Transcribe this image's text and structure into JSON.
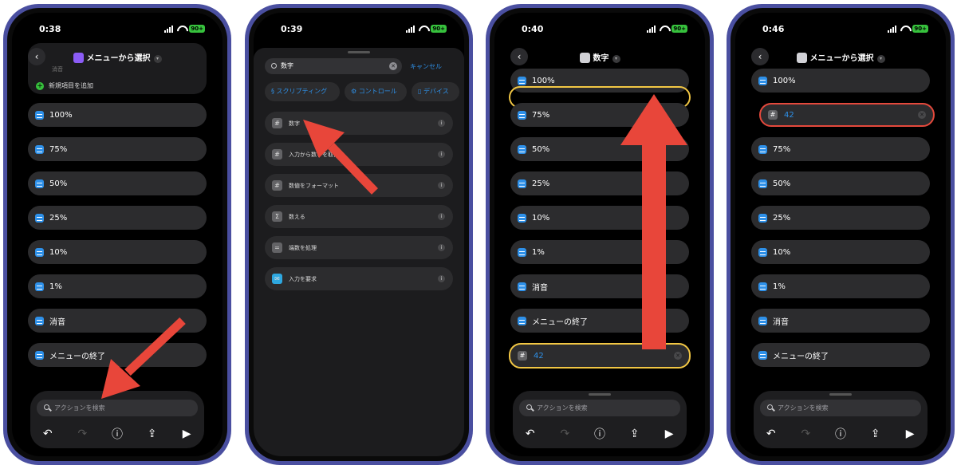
{
  "colors": {
    "accent": "#2e90e8",
    "battery": "#37c23d",
    "annotation_arrow": "#e8463a",
    "highlight_yellow": "#f2c744",
    "highlight_red": "#e5493c",
    "shortcut_icon": "#8b5cf6"
  },
  "phones": [
    {
      "time": "0:38",
      "battery": "90+",
      "title": "メニューから選択",
      "sheet_partial_label": "消音",
      "add_new_item": "新規項目を追加",
      "items": [
        "100%",
        "75%",
        "50%",
        "25%",
        "10%",
        "1%",
        "消音",
        "メニューの終了"
      ],
      "search_placeholder": "アクションを検索"
    },
    {
      "time": "0:39",
      "battery": "90+",
      "search_value": "数字",
      "cancel": "キャンセル",
      "chips": [
        "スクリプティング",
        "コントロール",
        "デバイス"
      ],
      "results": [
        {
          "label": "数字",
          "icon": "number-icon"
        },
        {
          "label": "入力から数字を取得",
          "icon": "number-icon"
        },
        {
          "label": "数値をフォーマット",
          "icon": "number-icon"
        },
        {
          "label": "数える",
          "icon": "sigma-icon"
        },
        {
          "label": "端数を処理",
          "icon": "equals-icon"
        },
        {
          "label": "入力を要求",
          "icon": "chat-icon"
        }
      ]
    },
    {
      "time": "0:40",
      "battery": "90+",
      "title": "数字",
      "items": [
        "100%",
        "75%",
        "50%",
        "25%",
        "10%",
        "1%",
        "消音",
        "メニューの終了"
      ],
      "number_value": "42",
      "search_placeholder": "アクションを検索"
    },
    {
      "time": "0:46",
      "battery": "90+",
      "title": "メニューから選択",
      "items_top": [
        "100%"
      ],
      "number_value": "42",
      "items": [
        "75%",
        "50%",
        "25%",
        "10%",
        "1%",
        "消音",
        "メニューの終了"
      ],
      "search_placeholder": "アクションを検索"
    }
  ]
}
